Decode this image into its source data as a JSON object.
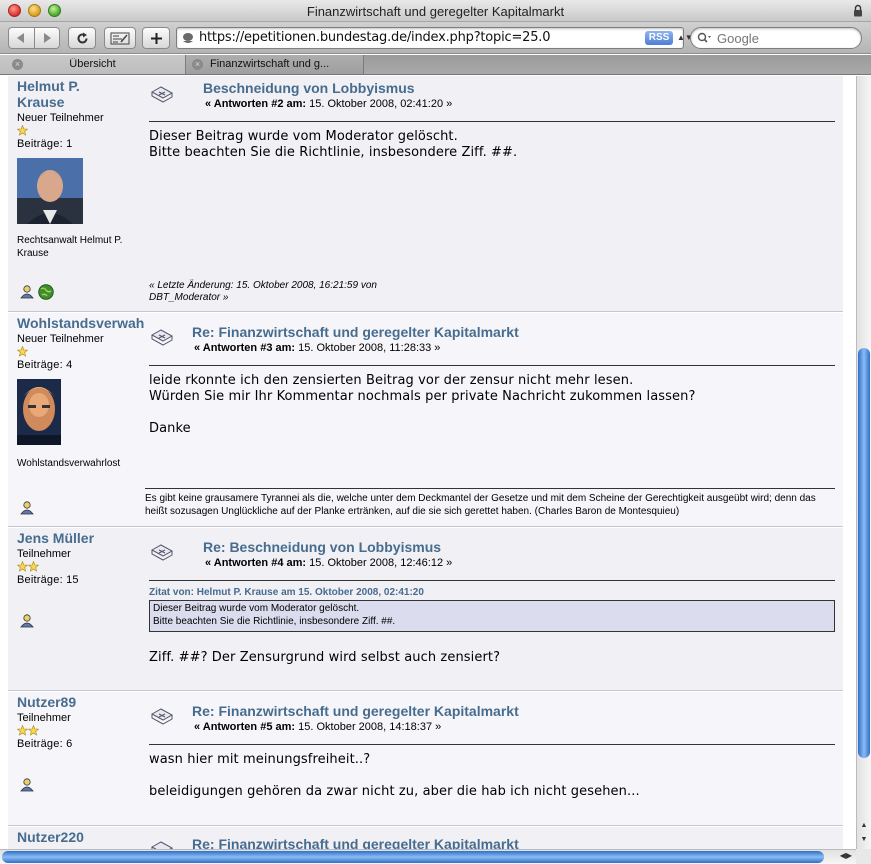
{
  "window": {
    "title": "Finanzwirtschaft und geregelter Kapitalmarkt"
  },
  "toolbar": {
    "url": "https://epetitionen.bundestag.de/index.php?topic=25.0",
    "rss_label": "RSS",
    "search_placeholder": "Google"
  },
  "tabs": [
    {
      "label": "Übersicht",
      "active": false
    },
    {
      "label": "Finanzwirtschaft und g...",
      "active": true
    }
  ],
  "posts": [
    {
      "author": "Helmut P. Krause",
      "author_line2": "",
      "group": "Neuer Teilnehmer",
      "stars": 1,
      "posts_count": "Beiträge: 1",
      "personal_text": "Rechtsanwalt Helmut P. Krause",
      "title": "Beschneidung von Lobbyismus",
      "reply_label": "« Antworten #2 am:",
      "date": "15. Oktober 2008, 02:41:20 »",
      "lines": [
        "Dieser Beitrag wurde vom Moderator gelöscht.",
        "Bitte beachten Sie die Richtlinie, insbesondere Ziff. ##."
      ],
      "edit_note": "« Letzte Änderung: 15. Oktober 2008, 16:21:59 von DBT_Moderator »"
    },
    {
      "author": "Wohlstandsverwahrlost",
      "group": "Neuer Teilnehmer",
      "stars": 1,
      "posts_count": "Beiträge: 4",
      "personal_text": "Wohlstandsverwahrlost",
      "title": "Re: Finanzwirtschaft und geregelter Kapitalmarkt",
      "reply_label": "« Antworten #3 am:",
      "date": "15. Oktober 2008, 11:28:33 »",
      "lines": [
        "leide rkonnte ich den zensierten Beitrag vor der zensur nicht mehr lesen.",
        "Würden Sie mir Ihr Kommentar nochmals per private Nachricht zukommen lassen?",
        "",
        "Danke"
      ],
      "signature": "Es gibt keine grausamere Tyrannei als die, welche unter dem Deckmantel der Gesetze und mit dem Scheine der Gerechtigkeit ausgeübt wird; denn das heißt sozusagen Unglückliche auf der Planke ertränken, auf die sie sich gerettet haben. (Charles Baron de Montesquieu)"
    },
    {
      "author": "Jens Müller",
      "group": "Teilnehmer",
      "stars": 2,
      "posts_count": "Beiträge: 15",
      "title": "Re: Beschneidung von Lobbyismus",
      "reply_label": "« Antworten #4 am:",
      "date": "15. Oktober 2008, 12:46:12 »",
      "quote_header": "Zitat von: Helmut P. Krause am 15. Oktober 2008, 02:41:20",
      "quote_lines": [
        "Dieser Beitrag wurde vom Moderator gelöscht.",
        "Bitte beachten Sie die Richtlinie, insbesondere Ziff. ##."
      ],
      "lines": [
        "Ziff. ##? Der Zensurgrund wird selbst auch zensiert?"
      ]
    },
    {
      "author": "Nutzer89",
      "group": "Teilnehmer",
      "stars": 2,
      "posts_count": "Beiträge: 6",
      "title": "Re: Finanzwirtschaft und geregelter Kapitalmarkt",
      "reply_label": "« Antworten #5 am:",
      "date": "15. Oktober 2008, 14:18:37 »",
      "lines": [
        "wasn hier mit meinungsfreiheit..?",
        "",
        "beleidigungen gehören da zwar nicht zu, aber die hab ich nicht gesehen..."
      ]
    },
    {
      "author": "Nutzer220",
      "title": "Re: Finanzwirtschaft und geregelter Kapitalmarkt"
    }
  ],
  "colors": {
    "link": "#476c8e",
    "post_bg": "#f0f0f5",
    "quote_bg": "#dcdcef",
    "scroll_thumb": "#2f6fc9"
  },
  "icons": [
    "back-icon",
    "forward-icon",
    "reload-icon",
    "snapback-icon",
    "add-bookmark-icon",
    "lock-icon",
    "search-icon",
    "post-xx-icon",
    "user-profile-icon",
    "www-globe-icon",
    "star-icon"
  ]
}
